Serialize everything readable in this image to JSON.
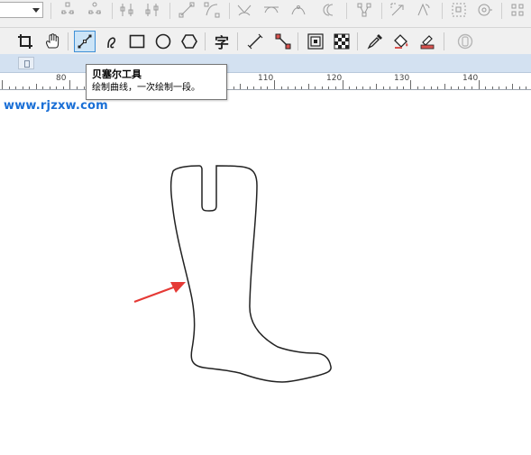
{
  "property_bar": {
    "icons": [
      "node-align-icon",
      "node-distribute-icon",
      "curve-to-line-icon",
      "line-to-curve-icon",
      "cusp-node-icon",
      "smooth-node-icon",
      "symmetric-node-icon",
      "reverse-direction-icon",
      "extract-subpath-icon",
      "stretch-nodes-icon",
      "rotate-nodes-icon",
      "elastic-mode-icon"
    ]
  },
  "toolbox": {
    "tools": [
      {
        "name": "crop-tool",
        "icon": "crop-icon"
      },
      {
        "name": "pan-tool",
        "icon": "hand-icon"
      },
      {
        "name": "bezier-tool",
        "icon": "bezier-icon",
        "active": true
      },
      {
        "name": "artistic-media-tool",
        "icon": "artistic-media-icon"
      },
      {
        "name": "rectangle-tool",
        "icon": "rectangle-icon"
      },
      {
        "name": "ellipse-tool",
        "icon": "ellipse-icon"
      },
      {
        "name": "polygon-tool",
        "icon": "polygon-icon"
      },
      {
        "name": "text-tool",
        "icon": "text-icon",
        "glyph": "字"
      },
      {
        "name": "dimension-tool",
        "icon": "dimension-icon"
      },
      {
        "name": "connector-tool",
        "icon": "connector-icon"
      },
      {
        "name": "contour-tool",
        "icon": "contour-icon"
      },
      {
        "name": "transparency-tool",
        "icon": "transparency-icon"
      },
      {
        "name": "eyedropper-tool",
        "icon": "eyedropper-icon"
      },
      {
        "name": "interactive-fill-tool",
        "icon": "fill-icon"
      },
      {
        "name": "smart-fill-tool",
        "icon": "smart-fill-icon"
      },
      {
        "name": "outline-tool",
        "icon": "outline-icon"
      }
    ]
  },
  "ruler": {
    "labels": [
      "80",
      "110",
      "120",
      "130",
      "140"
    ]
  },
  "tooltip": {
    "title": "贝塞尔工具",
    "description": "绘制曲线，一次绘制一段。"
  },
  "watermark": "www.rjzxw.com",
  "colors": {
    "accent": "#3f8fd6",
    "arrow": "#e53935",
    "watermark": "#1a6fd6",
    "tab_strip": "#d3e1f1"
  }
}
